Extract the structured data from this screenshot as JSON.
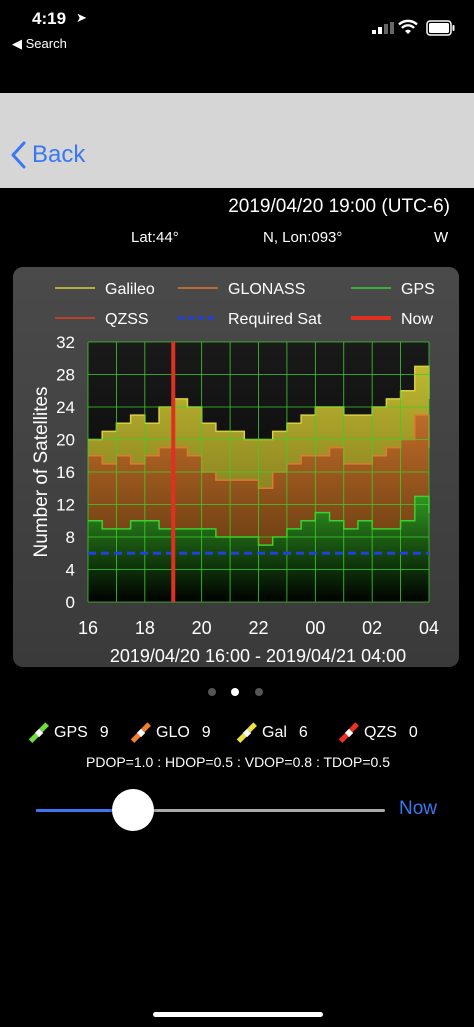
{
  "status_bar": {
    "time": "4:19",
    "back_app": "◀ Search"
  },
  "nav": {
    "back_label": "Back"
  },
  "header": {
    "datetime": "2019/04/20 19:00 (UTC-6)",
    "lat": "Lat:44°",
    "lon": "N, Lon:093°",
    "lon_dir": "W"
  },
  "legend": [
    "Galileo",
    "GLONASS",
    "GPS",
    "QZSS",
    "Required Sat",
    "Now"
  ],
  "colors": {
    "galileo": "#d8d040",
    "glonass": "#e07830",
    "gps": "#3cd030",
    "qzss": "#e04020",
    "required": "#2040e0",
    "now": "#e03020",
    "accent": "#3a78f2"
  },
  "satellites": [
    {
      "name": "GPS",
      "count": "9",
      "color": "#6ee03a"
    },
    {
      "name": "GLO",
      "count": "9",
      "color": "#f08030"
    },
    {
      "name": "Gal",
      "count": "6",
      "color": "#f0e040"
    },
    {
      "name": "QZS",
      "count": "0",
      "color": "#f03020"
    }
  ],
  "dop": "PDOP=1.0 : HDOP=0.5 : VDOP=0.8 : TDOP=0.5",
  "slider": {
    "now_label": "Now",
    "position": 0.2
  },
  "chart_data": {
    "type": "area",
    "ylabel": "Number of Satellites",
    "xlabel": "2019/04/20 16:00 - 2019/04/21 04:00",
    "x_ticks": [
      "16",
      "18",
      "20",
      "22",
      "00",
      "02",
      "04"
    ],
    "y_ticks": [
      "0",
      "4",
      "8",
      "12",
      "16",
      "20",
      "24",
      "28",
      "32"
    ],
    "ylim": [
      0,
      32
    ],
    "x_hours": [
      16,
      16.5,
      17,
      17.5,
      18,
      18.5,
      19,
      19.5,
      20,
      20.5,
      21,
      21.5,
      22,
      22.5,
      23,
      23.5,
      0,
      0.5,
      1,
      1.5,
      2,
      2.5,
      3,
      3.5,
      4
    ],
    "series": [
      {
        "name": "GPS",
        "values": [
          10,
          9,
          9,
          10,
          10,
          9,
          9,
          9,
          9,
          8,
          8,
          8,
          7,
          8,
          9,
          10,
          11,
          10,
          9,
          10,
          9,
          9,
          10,
          13,
          11
        ]
      },
      {
        "name": "GLONASS",
        "values": [
          18,
          17,
          18,
          17,
          18,
          19,
          19,
          18,
          16,
          15,
          15,
          15,
          14,
          16,
          17,
          18,
          18,
          19,
          17,
          17,
          18,
          19,
          20,
          23,
          19
        ]
      },
      {
        "name": "Galileo",
        "values": [
          20,
          21,
          22,
          23,
          22,
          24,
          25,
          24,
          22,
          21,
          21,
          20,
          20,
          21,
          22,
          23,
          24,
          24,
          23,
          23,
          24,
          25,
          26,
          29,
          25
        ]
      },
      {
        "name": "QZSS",
        "values": [
          0,
          0,
          0,
          0,
          0,
          0,
          0,
          0,
          0,
          0,
          0,
          0,
          0,
          0,
          0,
          0,
          0,
          0,
          0,
          0,
          0,
          0,
          0,
          0,
          0
        ]
      }
    ],
    "required_sat": 6,
    "now_hour": 19
  }
}
